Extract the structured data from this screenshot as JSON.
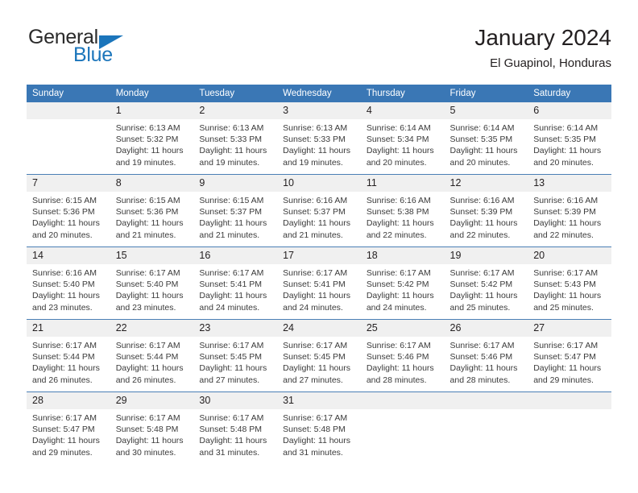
{
  "brand": {
    "name_part1": "General",
    "name_part2": "Blue",
    "triangle_color": "#1b75bb"
  },
  "header": {
    "title": "January 2024",
    "subtitle": "El Guapinol, Honduras"
  },
  "theme": {
    "header_bg": "#3a77b5",
    "daynum_bg": "#f0f0f0",
    "row_rule": "#4a7fb5",
    "text": "#231f20"
  },
  "weekday_headers": [
    "Sunday",
    "Monday",
    "Tuesday",
    "Wednesday",
    "Thursday",
    "Friday",
    "Saturday"
  ],
  "weeks": [
    [
      {
        "day": "",
        "empty": true,
        "sunrise": "",
        "sunset": "",
        "daylight1": "",
        "daylight2": ""
      },
      {
        "day": "1",
        "sunrise": "Sunrise: 6:13 AM",
        "sunset": "Sunset: 5:32 PM",
        "daylight1": "Daylight: 11 hours",
        "daylight2": "and 19 minutes."
      },
      {
        "day": "2",
        "sunrise": "Sunrise: 6:13 AM",
        "sunset": "Sunset: 5:33 PM",
        "daylight1": "Daylight: 11 hours",
        "daylight2": "and 19 minutes."
      },
      {
        "day": "3",
        "sunrise": "Sunrise: 6:13 AM",
        "sunset": "Sunset: 5:33 PM",
        "daylight1": "Daylight: 11 hours",
        "daylight2": "and 19 minutes."
      },
      {
        "day": "4",
        "sunrise": "Sunrise: 6:14 AM",
        "sunset": "Sunset: 5:34 PM",
        "daylight1": "Daylight: 11 hours",
        "daylight2": "and 20 minutes."
      },
      {
        "day": "5",
        "sunrise": "Sunrise: 6:14 AM",
        "sunset": "Sunset: 5:35 PM",
        "daylight1": "Daylight: 11 hours",
        "daylight2": "and 20 minutes."
      },
      {
        "day": "6",
        "sunrise": "Sunrise: 6:14 AM",
        "sunset": "Sunset: 5:35 PM",
        "daylight1": "Daylight: 11 hours",
        "daylight2": "and 20 minutes."
      }
    ],
    [
      {
        "day": "7",
        "sunrise": "Sunrise: 6:15 AM",
        "sunset": "Sunset: 5:36 PM",
        "daylight1": "Daylight: 11 hours",
        "daylight2": "and 20 minutes."
      },
      {
        "day": "8",
        "sunrise": "Sunrise: 6:15 AM",
        "sunset": "Sunset: 5:36 PM",
        "daylight1": "Daylight: 11 hours",
        "daylight2": "and 21 minutes."
      },
      {
        "day": "9",
        "sunrise": "Sunrise: 6:15 AM",
        "sunset": "Sunset: 5:37 PM",
        "daylight1": "Daylight: 11 hours",
        "daylight2": "and 21 minutes."
      },
      {
        "day": "10",
        "sunrise": "Sunrise: 6:16 AM",
        "sunset": "Sunset: 5:37 PM",
        "daylight1": "Daylight: 11 hours",
        "daylight2": "and 21 minutes."
      },
      {
        "day": "11",
        "sunrise": "Sunrise: 6:16 AM",
        "sunset": "Sunset: 5:38 PM",
        "daylight1": "Daylight: 11 hours",
        "daylight2": "and 22 minutes."
      },
      {
        "day": "12",
        "sunrise": "Sunrise: 6:16 AM",
        "sunset": "Sunset: 5:39 PM",
        "daylight1": "Daylight: 11 hours",
        "daylight2": "and 22 minutes."
      },
      {
        "day": "13",
        "sunrise": "Sunrise: 6:16 AM",
        "sunset": "Sunset: 5:39 PM",
        "daylight1": "Daylight: 11 hours",
        "daylight2": "and 22 minutes."
      }
    ],
    [
      {
        "day": "14",
        "sunrise": "Sunrise: 6:16 AM",
        "sunset": "Sunset: 5:40 PM",
        "daylight1": "Daylight: 11 hours",
        "daylight2": "and 23 minutes."
      },
      {
        "day": "15",
        "sunrise": "Sunrise: 6:17 AM",
        "sunset": "Sunset: 5:40 PM",
        "daylight1": "Daylight: 11 hours",
        "daylight2": "and 23 minutes."
      },
      {
        "day": "16",
        "sunrise": "Sunrise: 6:17 AM",
        "sunset": "Sunset: 5:41 PM",
        "daylight1": "Daylight: 11 hours",
        "daylight2": "and 24 minutes."
      },
      {
        "day": "17",
        "sunrise": "Sunrise: 6:17 AM",
        "sunset": "Sunset: 5:41 PM",
        "daylight1": "Daylight: 11 hours",
        "daylight2": "and 24 minutes."
      },
      {
        "day": "18",
        "sunrise": "Sunrise: 6:17 AM",
        "sunset": "Sunset: 5:42 PM",
        "daylight1": "Daylight: 11 hours",
        "daylight2": "and 24 minutes."
      },
      {
        "day": "19",
        "sunrise": "Sunrise: 6:17 AM",
        "sunset": "Sunset: 5:42 PM",
        "daylight1": "Daylight: 11 hours",
        "daylight2": "and 25 minutes."
      },
      {
        "day": "20",
        "sunrise": "Sunrise: 6:17 AM",
        "sunset": "Sunset: 5:43 PM",
        "daylight1": "Daylight: 11 hours",
        "daylight2": "and 25 minutes."
      }
    ],
    [
      {
        "day": "21",
        "sunrise": "Sunrise: 6:17 AM",
        "sunset": "Sunset: 5:44 PM",
        "daylight1": "Daylight: 11 hours",
        "daylight2": "and 26 minutes."
      },
      {
        "day": "22",
        "sunrise": "Sunrise: 6:17 AM",
        "sunset": "Sunset: 5:44 PM",
        "daylight1": "Daylight: 11 hours",
        "daylight2": "and 26 minutes."
      },
      {
        "day": "23",
        "sunrise": "Sunrise: 6:17 AM",
        "sunset": "Sunset: 5:45 PM",
        "daylight1": "Daylight: 11 hours",
        "daylight2": "and 27 minutes."
      },
      {
        "day": "24",
        "sunrise": "Sunrise: 6:17 AM",
        "sunset": "Sunset: 5:45 PM",
        "daylight1": "Daylight: 11 hours",
        "daylight2": "and 27 minutes."
      },
      {
        "day": "25",
        "sunrise": "Sunrise: 6:17 AM",
        "sunset": "Sunset: 5:46 PM",
        "daylight1": "Daylight: 11 hours",
        "daylight2": "and 28 minutes."
      },
      {
        "day": "26",
        "sunrise": "Sunrise: 6:17 AM",
        "sunset": "Sunset: 5:46 PM",
        "daylight1": "Daylight: 11 hours",
        "daylight2": "and 28 minutes."
      },
      {
        "day": "27",
        "sunrise": "Sunrise: 6:17 AM",
        "sunset": "Sunset: 5:47 PM",
        "daylight1": "Daylight: 11 hours",
        "daylight2": "and 29 minutes."
      }
    ],
    [
      {
        "day": "28",
        "sunrise": "Sunrise: 6:17 AM",
        "sunset": "Sunset: 5:47 PM",
        "daylight1": "Daylight: 11 hours",
        "daylight2": "and 29 minutes."
      },
      {
        "day": "29",
        "sunrise": "Sunrise: 6:17 AM",
        "sunset": "Sunset: 5:48 PM",
        "daylight1": "Daylight: 11 hours",
        "daylight2": "and 30 minutes."
      },
      {
        "day": "30",
        "sunrise": "Sunrise: 6:17 AM",
        "sunset": "Sunset: 5:48 PM",
        "daylight1": "Daylight: 11 hours",
        "daylight2": "and 31 minutes."
      },
      {
        "day": "31",
        "sunrise": "Sunrise: 6:17 AM",
        "sunset": "Sunset: 5:48 PM",
        "daylight1": "Daylight: 11 hours",
        "daylight2": "and 31 minutes."
      },
      {
        "day": "",
        "empty": true,
        "sunrise": "",
        "sunset": "",
        "daylight1": "",
        "daylight2": ""
      },
      {
        "day": "",
        "empty": true,
        "sunrise": "",
        "sunset": "",
        "daylight1": "",
        "daylight2": ""
      },
      {
        "day": "",
        "empty": true,
        "sunrise": "",
        "sunset": "",
        "daylight1": "",
        "daylight2": ""
      }
    ]
  ]
}
